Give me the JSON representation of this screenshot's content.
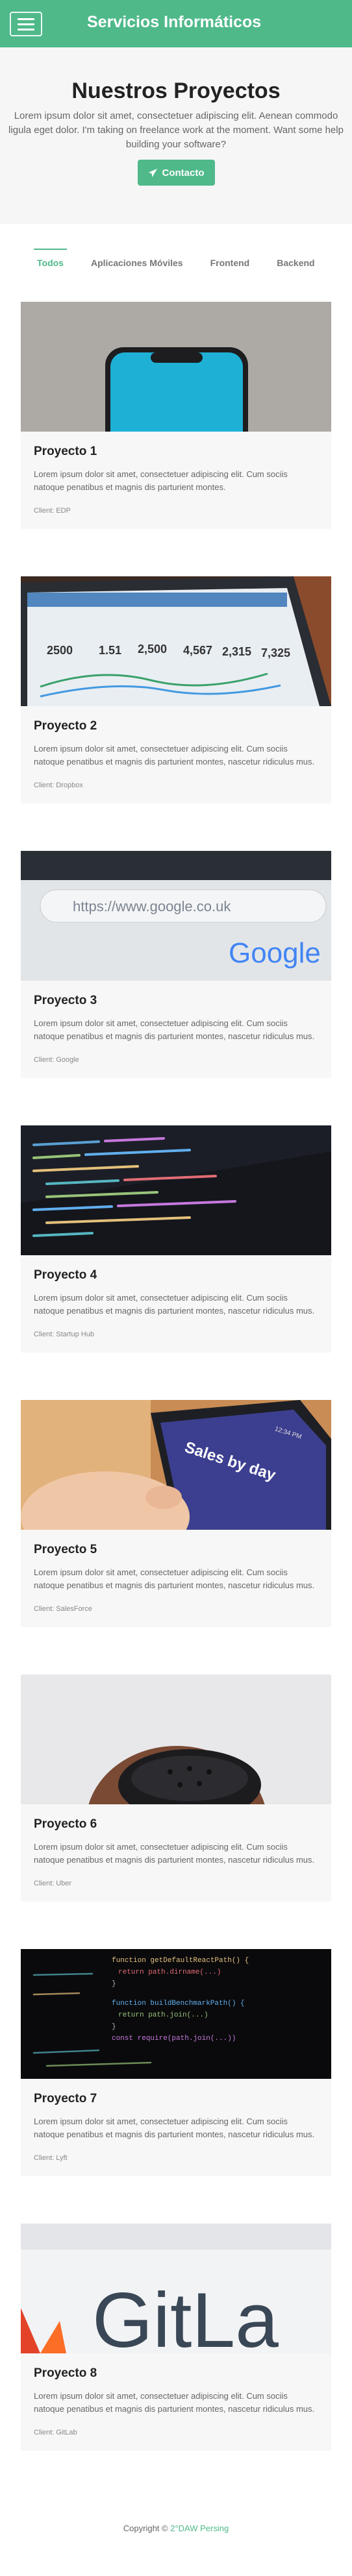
{
  "navbar": {
    "brand": "Servicios Informáticos",
    "menu_icon": "hamburger-icon"
  },
  "hero": {
    "title": "Nuestros Proyectos",
    "text": "Lorem ipsum dolor sit amet, consectetuer adipiscing elit. Aenean commodo ligula eget dolor. I'm taking on freelance work at the moment. Want some help building your software?",
    "button": "Contacto",
    "button_icon": "paper-plane-icon"
  },
  "tabs": [
    {
      "label": "Todos"
    },
    {
      "label": "Aplicaciones Móviles"
    },
    {
      "label": "Frontend"
    },
    {
      "label": "Backend"
    }
  ],
  "projects": [
    {
      "title": "Proyecto 1",
      "text": "Lorem ipsum dolor sit amet, consectetuer adipiscing elit. Cum sociis natoque penatibus et magnis dis parturient montes.",
      "client": "Client: EDP"
    },
    {
      "title": "Proyecto 2",
      "text": "Lorem ipsum dolor sit amet, consectetuer adipiscing elit. Cum sociis natoque penatibus et magnis dis parturient montes, nascetur ridiculus mus.",
      "client": "Client: Dropbox"
    },
    {
      "title": "Proyecto 3",
      "text": "Lorem ipsum dolor sit amet, consectetuer adipiscing elit. Cum sociis natoque penatibus et magnis dis parturient montes, nascetur ridiculus mus.",
      "client": "Client: Google"
    },
    {
      "title": "Proyecto 4",
      "text": "Lorem ipsum dolor sit amet, consectetuer adipiscing elit. Cum sociis natoque penatibus et magnis dis parturient montes, nascetur ridiculus mus.",
      "client": "Client: Startup Hub"
    },
    {
      "title": "Proyecto 5",
      "text": "Lorem ipsum dolor sit amet, consectetuer adipiscing elit. Cum sociis natoque penatibus et magnis dis parturient montes, nascetur ridiculus mus.",
      "client": "Client: SalesForce"
    },
    {
      "title": "Proyecto 6",
      "text": "Lorem ipsum dolor sit amet, consectetuer adipiscing elit. Cum sociis natoque penatibus et magnis dis parturient montes, nascetur ridiculus mus.",
      "client": "Client: Uber"
    },
    {
      "title": "Proyecto 7",
      "text": "Lorem ipsum dolor sit amet, consectetuer adipiscing elit. Cum sociis natoque penatibus et magnis dis parturient montes, nascetur ridiculus mus.",
      "client": "Client: Lyft"
    },
    {
      "title": "Proyecto 8",
      "text": "Lorem ipsum dolor sit amet, consectetuer adipiscing elit. Cum sociis natoque penatibus et magnis dis parturient montes, nascetur ridiculus mus.",
      "client": "Client: GitLab"
    }
  ],
  "project_images": {
    "p1": "phone-photo",
    "p2": "laptop-analytics-photo",
    "p3": "browser-google-photo",
    "p4": "code-screen-photo",
    "p5": "sales-app-photo",
    "p6": "vr-headset-photo",
    "p7": "react-code-photo",
    "p8": "gitlab-photo",
    "sp2_stats": [
      "2500",
      "1.51",
      "2,500",
      "4,567",
      "2,315",
      "7,325"
    ],
    "sp3_url": "https://www.google.co.uk",
    "sp3_logo": "Google",
    "sp5_title": "Sales by day",
    "sp5_time": "12:34 PM",
    "sp7_code": [
      "function getDefaultReactPath() {",
      "  return path.dirname(...)",
      "}",
      "function buildBenchmarkPath() {",
      "  return path.join(...)",
      "}",
      "const require(path.join(...))"
    ],
    "sp8_text": "GitLa"
  },
  "footer": {
    "prefix": "Copyright ©",
    "link": "2°DAW Persing"
  },
  "colors": {
    "accent": "#4fb98a",
    "hero_bg": "#f6f6f6",
    "card_bg": "#f7f7f7"
  }
}
